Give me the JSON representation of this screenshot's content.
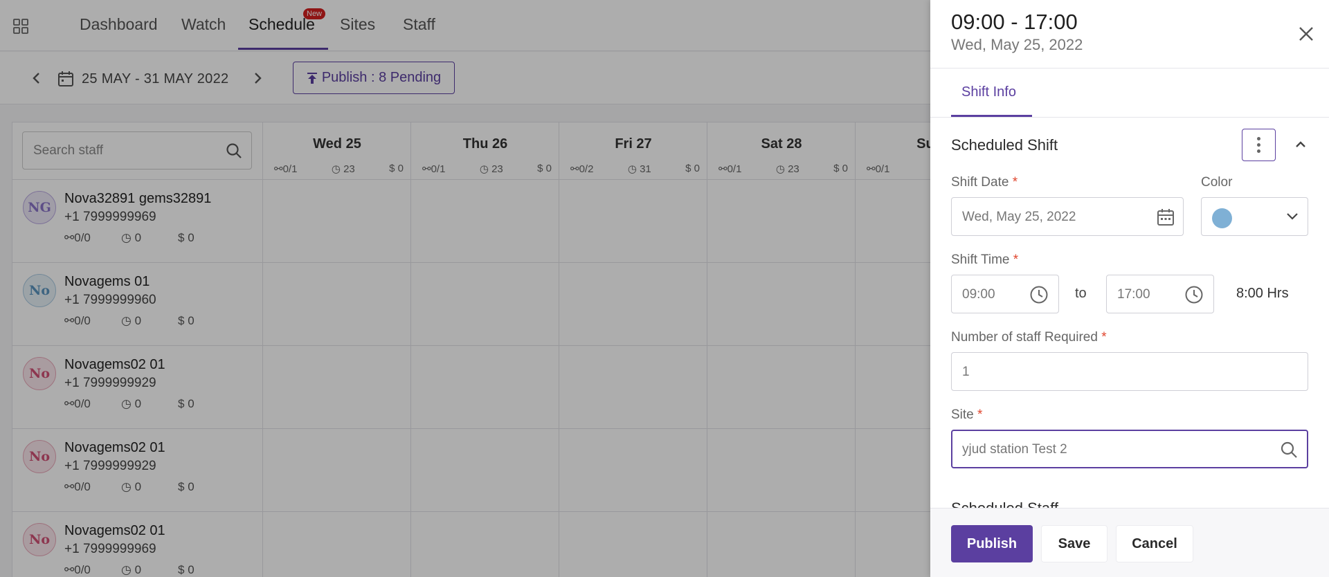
{
  "nav": {
    "items": [
      {
        "label": "Dashboard"
      },
      {
        "label": "Watch"
      },
      {
        "label": "Schedule",
        "badge": "New"
      },
      {
        "label": "Sites"
      },
      {
        "label": "Staff"
      }
    ],
    "active": "Schedule"
  },
  "toolbar": {
    "date_range": "25 MAY - 31 MAY 2022",
    "publish_label": "Publish : 8 Pending"
  },
  "schedule": {
    "search_placeholder": "Search staff",
    "days": [
      {
        "label": "Wed 25",
        "staff": "0/1",
        "hours": "23",
        "cost": "$ 0"
      },
      {
        "label": "Thu 26",
        "staff": "0/1",
        "hours": "23",
        "cost": "$ 0"
      },
      {
        "label": "Fri 27",
        "staff": "0/2",
        "hours": "31",
        "cost": "$ 0"
      },
      {
        "label": "Sat 28",
        "staff": "0/1",
        "hours": "23",
        "cost": "$ 0"
      },
      {
        "label": "Sun",
        "staff": "0/1",
        "hours": "",
        "cost": ""
      }
    ],
    "staff": [
      {
        "initials": "NG",
        "name": "Nova32891 gems32891",
        "phone": "+1 7999999969",
        "shifts": "0/0",
        "hours": "0",
        "cost": "0",
        "color": "purple"
      },
      {
        "initials": "No",
        "name": "Novagems 01",
        "phone": "+1 7999999960",
        "shifts": "0/0",
        "hours": "0",
        "cost": "0",
        "color": "blue"
      },
      {
        "initials": "No",
        "name": "Novagems02 01",
        "phone": "+1 7999999929",
        "shifts": "0/0",
        "hours": "0",
        "cost": "0",
        "color": "pink"
      },
      {
        "initials": "No",
        "name": "Novagems02 01",
        "phone": "+1 7999999929",
        "shifts": "0/0",
        "hours": "0",
        "cost": "0",
        "color": "pink"
      },
      {
        "initials": "No",
        "name": "Novagems02 01",
        "phone": "+1 7999999969",
        "shifts": "0/0",
        "hours": "0",
        "cost": "0",
        "color": "pink"
      }
    ]
  },
  "drawer": {
    "title": "09:00 - 17:00",
    "subtitle": "Wed, May 25, 2022",
    "tab": "Shift Info",
    "section_title": "Scheduled Shift",
    "shift_date_label": "Shift Date",
    "shift_date_value": "Wed, May 25, 2022",
    "color_label": "Color",
    "color_value": "#7fb0d5",
    "shift_time_label": "Shift Time",
    "start_time": "09:00",
    "to_label": "to",
    "end_time": "17:00",
    "duration": "8:00 Hrs",
    "staff_required_label": "Number of staff Required",
    "staff_required_value": "1",
    "site_label": "Site",
    "site_value": "yjud station Test 2",
    "scheduled_staff_title": "Scheduled Staff",
    "required_mark": "*",
    "buttons": {
      "publish": "Publish",
      "save": "Save",
      "cancel": "Cancel"
    }
  },
  "colors": {
    "accent": "#5b3fa0",
    "required": "#e0452d",
    "badge": "#d32020"
  }
}
